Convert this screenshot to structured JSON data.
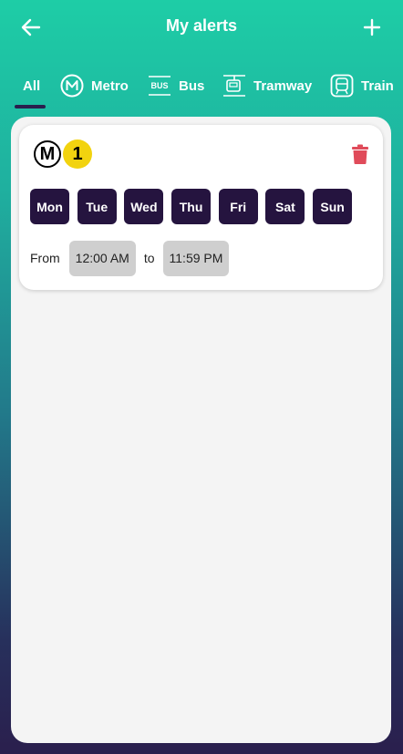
{
  "header": {
    "title": "My alerts"
  },
  "tabs": [
    {
      "label": "All",
      "icon": "none",
      "selected": true
    },
    {
      "label": "Metro",
      "icon": "metro-icon"
    },
    {
      "label": "Bus",
      "icon": "bus-icon",
      "icon_text": "BUS"
    },
    {
      "label": "Tramway",
      "icon": "tramway-icon"
    },
    {
      "label": "Train",
      "icon": "train-icon"
    }
  ],
  "alert": {
    "metro_symbol": "M",
    "line_number": "1",
    "line_color": "#f2d30f",
    "days": [
      "Mon",
      "Tue",
      "Wed",
      "Thu",
      "Fri",
      "Sat",
      "Sun"
    ],
    "from_label": "From",
    "from_time": "12:00 AM",
    "to_label": "to",
    "to_time": "11:59 PM",
    "delete_color": "#e04b5a"
  },
  "colors": {
    "accent_dark": "#25143f",
    "gradient_top": "#1ecda6",
    "gradient_bottom": "#2a1f4d"
  }
}
